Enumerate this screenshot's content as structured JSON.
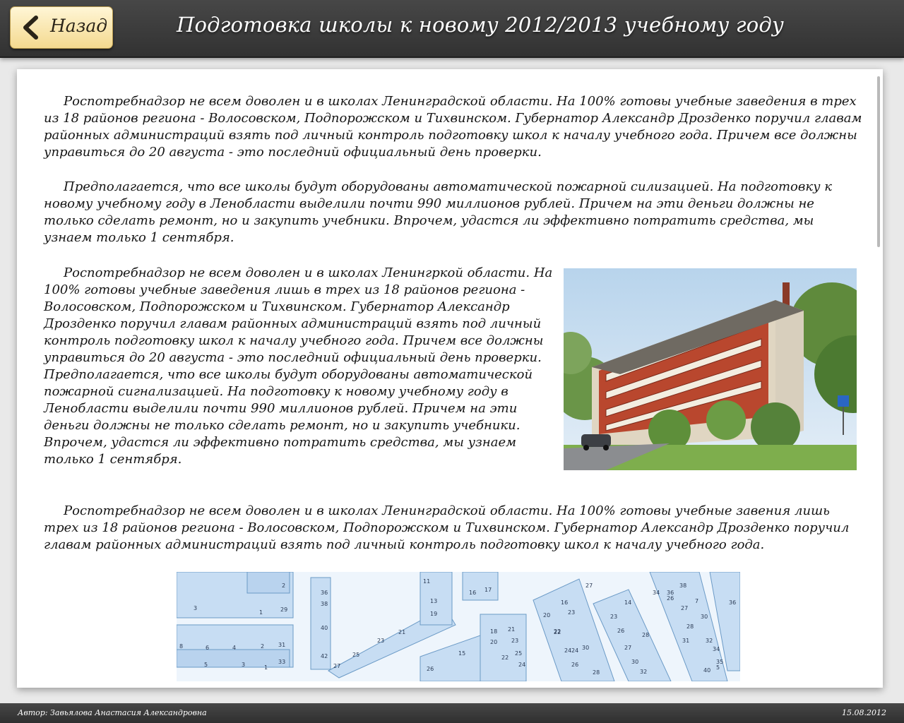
{
  "header": {
    "back_label": "Назад",
    "title": "Подготовка школы к новому 2012/2013 учебному году"
  },
  "article": {
    "paragraphs": [
      "Роспотребнадзор не всем доволен и в школах Ленинградской области. На 100% готовы учебные заведения в трех из 18 районов региона - Волосовском, Подпорожском и Тихвинском. Губернатор Александр Дрозденко поручил главам районных администраций взять под личный контроль подготовку школ к началу учебного года. Причем все должны управиться до 20 августа - это последний официальный день проверки.",
      "Предполагается, что все школы будут оборудованы автоматической пожарной силизацией. На подготовку к новому учебному году в Ленобласти выделили почти 990 миллионов рублей. Причем на эти деньги должны не только сделать ремонт, но и закупить учебники. Впрочем, удастся ли эффективно потратить средства, мы узнаем только 1 сентября.",
      "Роспотребнадзор не всем доволен и в школах Ленингркой области. На 100% готовы учебные заведения  лишь в трех из 18 районов региона - Волосовском, Подпорожском и Тихвинском. Губернатор Александр Дрозденко поручил главам районных администраций взять под личный контроль подготовку школ к началу учебного года. Причем все должны управиться до 20 августа - это последний официальный день проверки. Предполагается, что все школы будут оборудованы автоматической пожарной сигнализацией. На подготовку к новому учебному году в Ленобласти выделили почти 990 миллионов рублей. Причем на эти деньги должны не только сделать ремонт, но и закупить учебники. Впрочем, удастся ли эффективно потратить средства, мы узнаем только 1 сентября.",
      "Роспотребнадзор не всем доволен и в школах Ленинградской области. На 100% готовы учебные завения лишь трех из 18 районов региона - Волосовском, Подпорожском и Тихвинском. Губернатор Александр Дрозденко поручил главам районных администраций взять под личный контроль подготовку школ к началу учебного года."
    ]
  },
  "map": {
    "labels": [
      "2",
      "3",
      "1",
      "29",
      "8",
      "6",
      "4",
      "2",
      "31",
      "5",
      "3",
      "1",
      "33",
      "36",
      "38",
      "40",
      "42",
      "27",
      "25",
      "23",
      "21",
      "19",
      "13",
      "11",
      "16",
      "17",
      "18",
      "20",
      "22",
      "24",
      "26",
      "15",
      "21",
      "23",
      "20",
      "22",
      "24",
      "25",
      "16",
      "23",
      "22",
      "24",
      "26",
      "28",
      "30",
      "27",
      "14",
      "23",
      "26",
      "28",
      "27",
      "30",
      "32",
      "34",
      "36",
      "38",
      "26",
      "27",
      "28",
      "31",
      "30",
      "32",
      "34",
      "35",
      "40",
      "5",
      "7",
      "36",
      "34",
      "2"
    ]
  },
  "footer": {
    "author": "Автор: Завьялова Анастасия Александровна",
    "date": "15.08.2012"
  },
  "colors": {
    "bar": "#3a3a3a",
    "button": "#f6dd98",
    "text": "#151515"
  }
}
